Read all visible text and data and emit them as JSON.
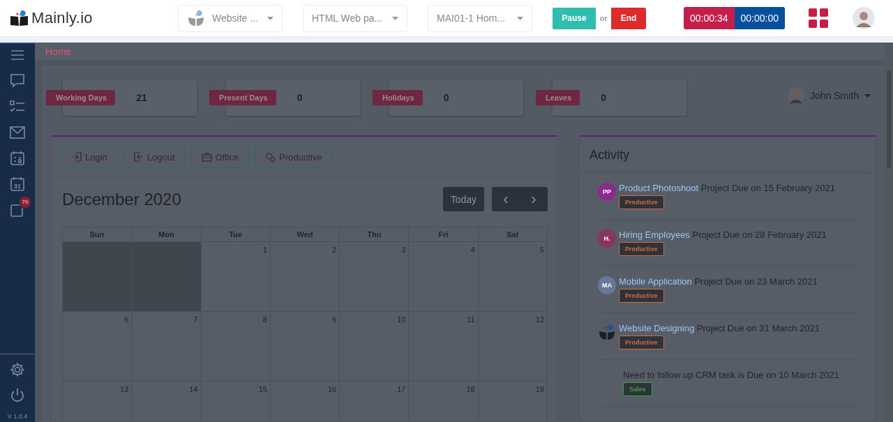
{
  "header": {
    "brand": "Mainly.io",
    "dropdowns": [
      {
        "label": "Website ...",
        "icon": true
      },
      {
        "label": "HTML Web pa...",
        "icon": false
      },
      {
        "label": "MAI01-1 Hom...",
        "icon": false
      }
    ],
    "pause": "Pause",
    "or": "or",
    "end": "End",
    "timers": [
      {
        "kind": "elapsed",
        "text": "00:00:34"
      },
      {
        "kind": "total",
        "text": "00:00:00"
      }
    ]
  },
  "sidebar": {
    "items": [
      {
        "kind": "menu"
      },
      {
        "kind": "chat"
      },
      {
        "kind": "tasks"
      },
      {
        "kind": "mail"
      },
      {
        "kind": "calendar"
      },
      {
        "kind": "date",
        "icon_text": "31"
      },
      {
        "kind": "note",
        "badge": "70"
      }
    ],
    "bottom": [
      {
        "kind": "settings"
      },
      {
        "kind": "power"
      }
    ],
    "version": "V 1.0.4"
  },
  "breadcrumb": "Home",
  "stats": [
    {
      "label": "Working Days",
      "value": "21"
    },
    {
      "label": "Present Days",
      "value": "0"
    },
    {
      "label": "Holidays",
      "value": "0"
    },
    {
      "label": "Leaves",
      "value": "0"
    }
  ],
  "user": {
    "name": "John Smith"
  },
  "calendar": {
    "actions": [
      {
        "kind": "login",
        "label": "Login"
      },
      {
        "kind": "logout",
        "label": "Logout"
      },
      {
        "kind": "office",
        "label": "Office"
      },
      {
        "kind": "productive",
        "label": "Productive"
      }
    ],
    "title": "December 2020",
    "today": "Today",
    "prev": "‹",
    "next": "›",
    "days": [
      "Sun",
      "Mon",
      "Tue",
      "Wed",
      "Thu",
      "Fri",
      "Sat"
    ],
    "weeks": [
      [
        {
          "outside": true
        },
        {
          "outside": true
        },
        {
          "day": "1",
          "outside": false
        },
        {
          "day": "2",
          "outside": false
        },
        {
          "day": "3",
          "outside": false
        },
        {
          "day": "4",
          "outside": false
        },
        {
          "day": "5",
          "outside": false
        }
      ],
      [
        {
          "day": "6",
          "outside": false
        },
        {
          "day": "7",
          "outside": false
        },
        {
          "day": "8",
          "outside": false
        },
        {
          "day": "9",
          "outside": false
        },
        {
          "day": "10",
          "outside": false
        },
        {
          "day": "11",
          "outside": false
        },
        {
          "day": "12",
          "outside": false
        }
      ],
      [
        {
          "day": "13",
          "outside": false
        },
        {
          "day": "14",
          "outside": false
        },
        {
          "day": "15",
          "outside": false
        },
        {
          "day": "16",
          "outside": false
        },
        {
          "day": "17",
          "outside": false
        },
        {
          "day": "18",
          "outside": false
        },
        {
          "day": "19",
          "outside": false
        }
      ]
    ]
  },
  "activity": {
    "title": "Activity",
    "items": [
      {
        "avatar": {
          "kind": "initials",
          "initials": "PP",
          "color": "#8a2a8e"
        },
        "link": "Product Photoshoot",
        "text": "Project Due on 15 February 2021",
        "tag": {
          "label": "Productive",
          "color": "#d06a40"
        }
      },
      {
        "avatar": {
          "kind": "initials",
          "initials": "H.",
          "color": "#8a3560"
        },
        "link": "Hiring Employees",
        "text": "Project Due on 28 February 2021",
        "tag": {
          "label": "Productive",
          "color": "#d06a40"
        }
      },
      {
        "avatar": {
          "kind": "initials",
          "initials": "MA",
          "color": "#69779a"
        },
        "link": "Mobile Application",
        "text": "Project Due on 23 March 2021",
        "tag": {
          "label": "Productive",
          "color": "#d06a40"
        }
      },
      {
        "avatar": {
          "kind": "logo"
        },
        "link": "Website Designing",
        "text": "Project Due on 31 March 2021",
        "tag": {
          "label": "Productive",
          "color": "#d06a40"
        }
      },
      {
        "avatar": {
          "kind": "none"
        },
        "text": "Need to follow up CRM task is Due on 10 March 2021",
        "tag": {
          "label": "Sales",
          "color": "#3aa04a"
        }
      }
    ]
  }
}
